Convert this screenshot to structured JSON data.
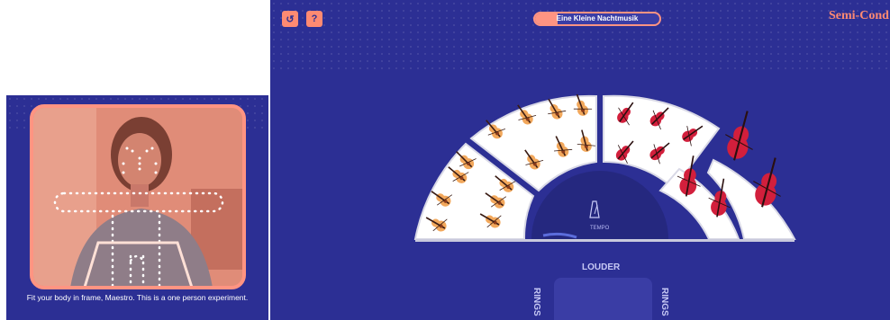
{
  "camera": {
    "instruction": "Fit your body in frame, Maestro. This is a one person experiment."
  },
  "toolbar": {
    "restart_icon": "↺",
    "help_label": "?"
  },
  "song": {
    "title": "Eine Kleine Nachtmusik",
    "progress": 0.18
  },
  "brand": {
    "name": "Semi-Cond"
  },
  "stage": {
    "tempo_label": "TEMPO",
    "louder_label": "LOUDER",
    "strings_left_label": "RINGS",
    "strings_right_label": "RINGS"
  },
  "colors": {
    "background": "#2c2f94",
    "accent": "#ff8a72",
    "section_fill": "#f4f4f4",
    "instrument": "#c8102e"
  }
}
